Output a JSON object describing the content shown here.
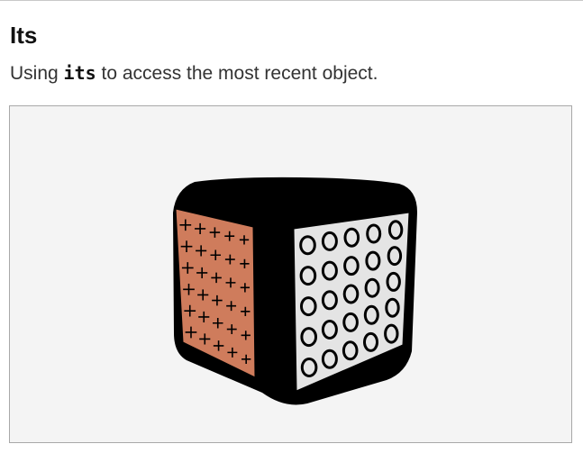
{
  "page": {
    "title": "Its",
    "description_prefix": "Using ",
    "description_code": "its",
    "description_suffix": " to access the most recent object."
  },
  "scene": {
    "background_color": "#f4f4f4",
    "object": {
      "body_color": "#000000",
      "left_face": {
        "color": "#cf7c5c",
        "glyph": "+",
        "rows": 6,
        "cols": 5
      },
      "right_face": {
        "color": "#e4e4e4",
        "glyph": "O",
        "rows": 5,
        "cols": 5
      }
    }
  }
}
